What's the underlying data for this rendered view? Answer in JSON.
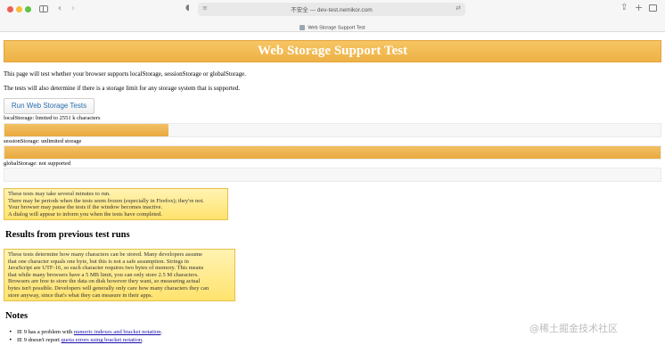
{
  "browser": {
    "address_text": "不安全 — dev-test.nemikor.com",
    "address_left_icon": "≡",
    "address_right_icon": "⇄",
    "tab_title": "Web Storage Support Test"
  },
  "page": {
    "title": "Web Storage Support Test",
    "intro1": "This page will test whether your browser supports localStorage, sessionStorage or globalStorage.",
    "intro2": "The tests will also determine if there is a storage limit for any storage system that is supported.",
    "run_button": "Run Web Storage Tests"
  },
  "storages": [
    {
      "label": "localStorage: limited to 2551 k characters",
      "fill": 0.25
    },
    {
      "label": "sessionStorage: unlimited storage",
      "fill": 1.0
    },
    {
      "label": "globalStorage: not supported",
      "fill": 0.0
    }
  ],
  "warning_lines": [
    "These tests may take several minutes to run.",
    "There may be periods when the tests seem frozen (especially in Firefox); they're not.",
    "Your browser may pause the tests if the window becomes inactive.",
    "A dialog will appear to inform you when the tests have completed."
  ],
  "results_heading": "Results from previous test runs",
  "results_lines": [
    "These tests determine how many characters can be stored. Many developers assume",
    "that one character equals one byte, but this is not a safe assumption. Strings in",
    "JavaScript are UTF-16, so each character requires two bytes of memory. This means",
    "that while many browsers have a 5 MB limit, you can only store 2.5 M characters.",
    "Browsers are free to store the data on disk however they want, so measuring actual",
    "bytes isn't possible. Developers will generally only care how many characters they can",
    "store anyway, since that's what they can measure in their apps."
  ],
  "notes_heading": "Notes",
  "notes": [
    {
      "prefix": "IE 9 has a problem with ",
      "link": "numeric indexes and bracket notation",
      "suffix": "."
    },
    {
      "prefix": "IE 9 doesn't report ",
      "link": "quota errors using bracket notation",
      "suffix": "."
    }
  ],
  "watermark": "@稀土掘金技术社区"
}
